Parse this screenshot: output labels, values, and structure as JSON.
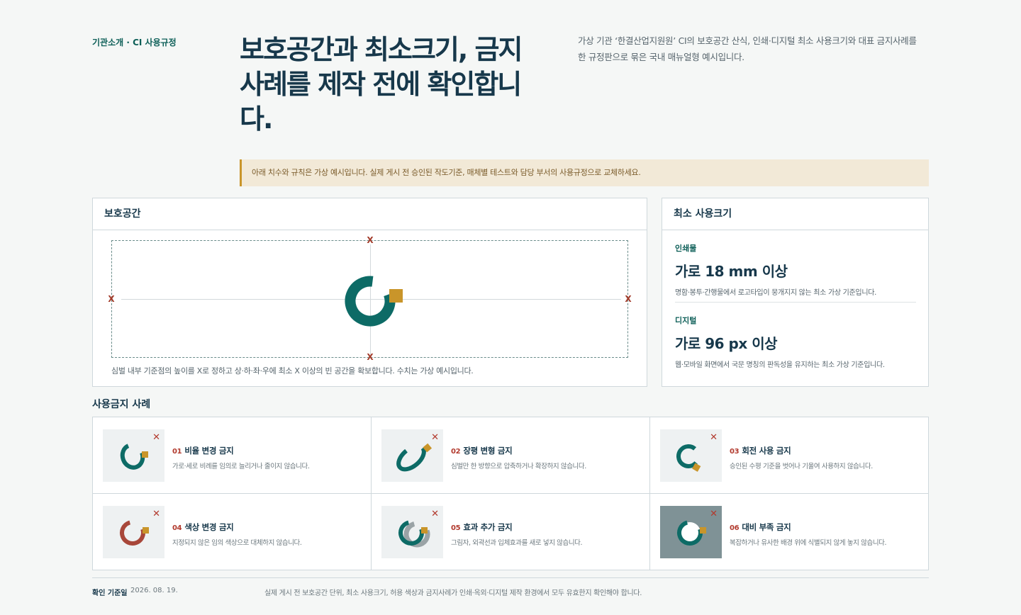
{
  "header": {
    "eyebrow": "기관소개 · CI 사용규정",
    "headline": "보호공간과 최소크기, 금지사례를 제작 전에 확인합니다.",
    "intro": "가상 기관 ‘한결산업지원원’ CI의 보호공간 산식, 인쇄·디지털 최소 사용크기와 대표 금지사례를 한 규정판으로 묶은 국내 매뉴얼형 예시입니다."
  },
  "notice": "아래 치수와 규칙은 가상 예시입니다. 실제 게시 전 승인된 작도기준, 매체별 테스트와 담당 부서의 사용규정으로 교체하세요.",
  "clear_space": {
    "title": "보호공간",
    "marker": "X",
    "caption": "심벌 내부 기준점의 높이를 X로 정하고 상·하·좌·우에 최소 X 이상의 빈 공간을 확보합니다. 수치는 가상 예시입니다."
  },
  "min_size": {
    "title": "최소 사용크기",
    "print": {
      "label": "인쇄물",
      "value": "가로 18 mm 이상",
      "desc": "명함·봉투·간행물에서 로고타입이 뭉개지지 않는 최소 가상 기준입니다."
    },
    "digital": {
      "label": "디지털",
      "value": "가로 96 px 이상",
      "desc": "웹·모바일 화면에서 국문 명칭의 판독성을 유지하는 최소 가상 기준입니다."
    }
  },
  "prohibited": {
    "title": "사용금지 사례",
    "items": [
      {
        "num": "01",
        "title": "비율 변경 금지",
        "desc": "가로·세로 비례를 임의로 늘리거나 줄이지 않습니다."
      },
      {
        "num": "02",
        "title": "장평 변형 금지",
        "desc": "심벌만 한 방향으로 압축하거나 확장하지 않습니다."
      },
      {
        "num": "03",
        "title": "회전 사용 금지",
        "desc": "승인된 수평 기준을 벗어나 기울여 사용하지 않습니다."
      },
      {
        "num": "04",
        "title": "색상 변경 금지",
        "desc": "지정되지 않은 임의 색상으로 대체하지 않습니다."
      },
      {
        "num": "05",
        "title": "효과 추가 금지",
        "desc": "그림자, 외곽선과 입체효과를 새로 넣지 않습니다."
      },
      {
        "num": "06",
        "title": "대비 부족 금지",
        "desc": "복잡하거나 유사한 배경 위에 식별되지 않게 놓지 않습니다."
      }
    ],
    "x_mark": "✕"
  },
  "footer": {
    "label": "확인 기준일",
    "date": "2026. 08. 19.",
    "note": "실제 게시 전 보호공간 단위, 최소 사용크기, 허용 색상과 금지사례가 인쇄·옥외·디지털 제작 환경에서 모두 유효한지 확인해야 합니다."
  },
  "colors": {
    "brand_teal": "#0d6b66",
    "brand_gold": "#c9952a",
    "alert_red": "#b23a2e"
  }
}
